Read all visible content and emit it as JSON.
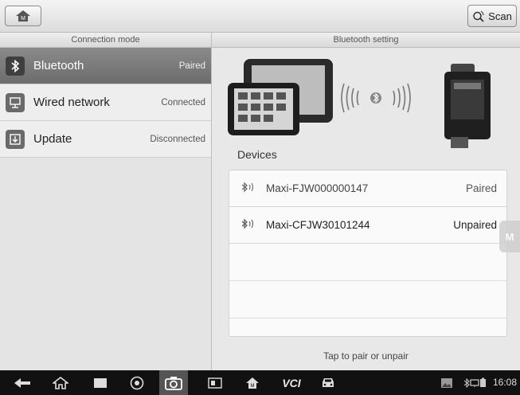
{
  "topbar": {
    "home_icon": "home-icon",
    "scan_label": "Scan",
    "scan_icon": "scan-icon"
  },
  "left_panel": {
    "header": "Connection mode",
    "items": [
      {
        "label": "Bluetooth",
        "status": "Paired",
        "icon": "bluetooth-icon",
        "selected": true
      },
      {
        "label": "Wired network",
        "status": "Connected",
        "icon": "network-icon",
        "selected": false
      },
      {
        "label": "Update",
        "status": "Disconnected",
        "icon": "update-icon",
        "selected": false
      }
    ]
  },
  "right_panel": {
    "header": "Bluetooth setting",
    "devices_title": "Devices",
    "devices": [
      {
        "name": "Maxi-FJW000000147",
        "status": "Paired"
      },
      {
        "name": "Maxi-CFJW30101244",
        "status": "Unpaired"
      }
    ],
    "hint": "Tap to pair or unpair"
  },
  "navbar": {
    "time": "16:08",
    "vci_label": "VCI"
  },
  "colors": {
    "selected_bg": "#7a7a7a",
    "navbar_bg": "#111111"
  }
}
